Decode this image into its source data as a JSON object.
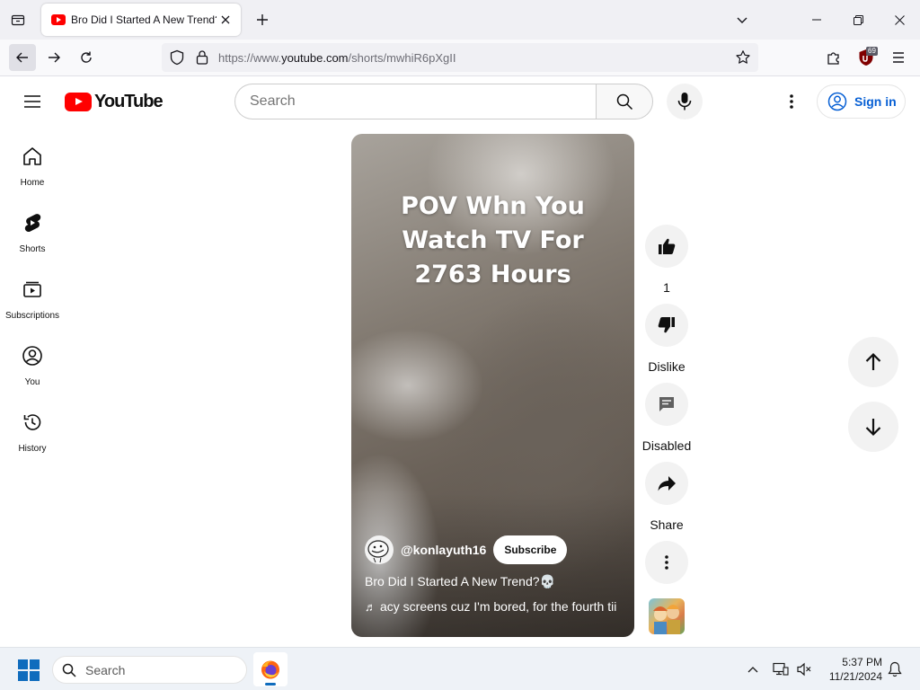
{
  "browser": {
    "tab_title": "Bro Did I Started A New Trend?",
    "url_prefix": "https://www.",
    "url_domain": "youtube.com",
    "url_path": "/shorts/mwhiR6pXgII",
    "ublock_count": "69"
  },
  "masthead": {
    "logo_text": "YouTube",
    "search_placeholder": "Search",
    "sign_in_label": "Sign in"
  },
  "guide": {
    "items": [
      {
        "label": "Home",
        "icon": "home-icon"
      },
      {
        "label": "Shorts",
        "icon": "shorts-icon"
      },
      {
        "label": "Subscriptions",
        "icon": "subscriptions-icon"
      },
      {
        "label": "You",
        "icon": "you-icon"
      },
      {
        "label": "History",
        "icon": "history-icon"
      }
    ]
  },
  "short": {
    "overlay_lines": [
      "POV Whn You",
      "Watch TV For",
      "2763 Hours"
    ],
    "channel_handle": "@konlayuth16",
    "subscribe_label": "Subscribe",
    "title": "Bro Did I Started A New Trend?💀",
    "music_text": "acy screens cuz I'm bored, for the fourth tii"
  },
  "actions": {
    "like_count": "1",
    "dislike_label": "Dislike",
    "comments_label": "Disabled",
    "share_label": "Share"
  },
  "taskbar": {
    "search_placeholder": "Search",
    "time": "5:37 PM",
    "date": "11/21/2024"
  },
  "colors": {
    "youtube_red": "#ff0000",
    "link_blue": "#065fd4",
    "windows_blue": "#0f6cbd"
  }
}
